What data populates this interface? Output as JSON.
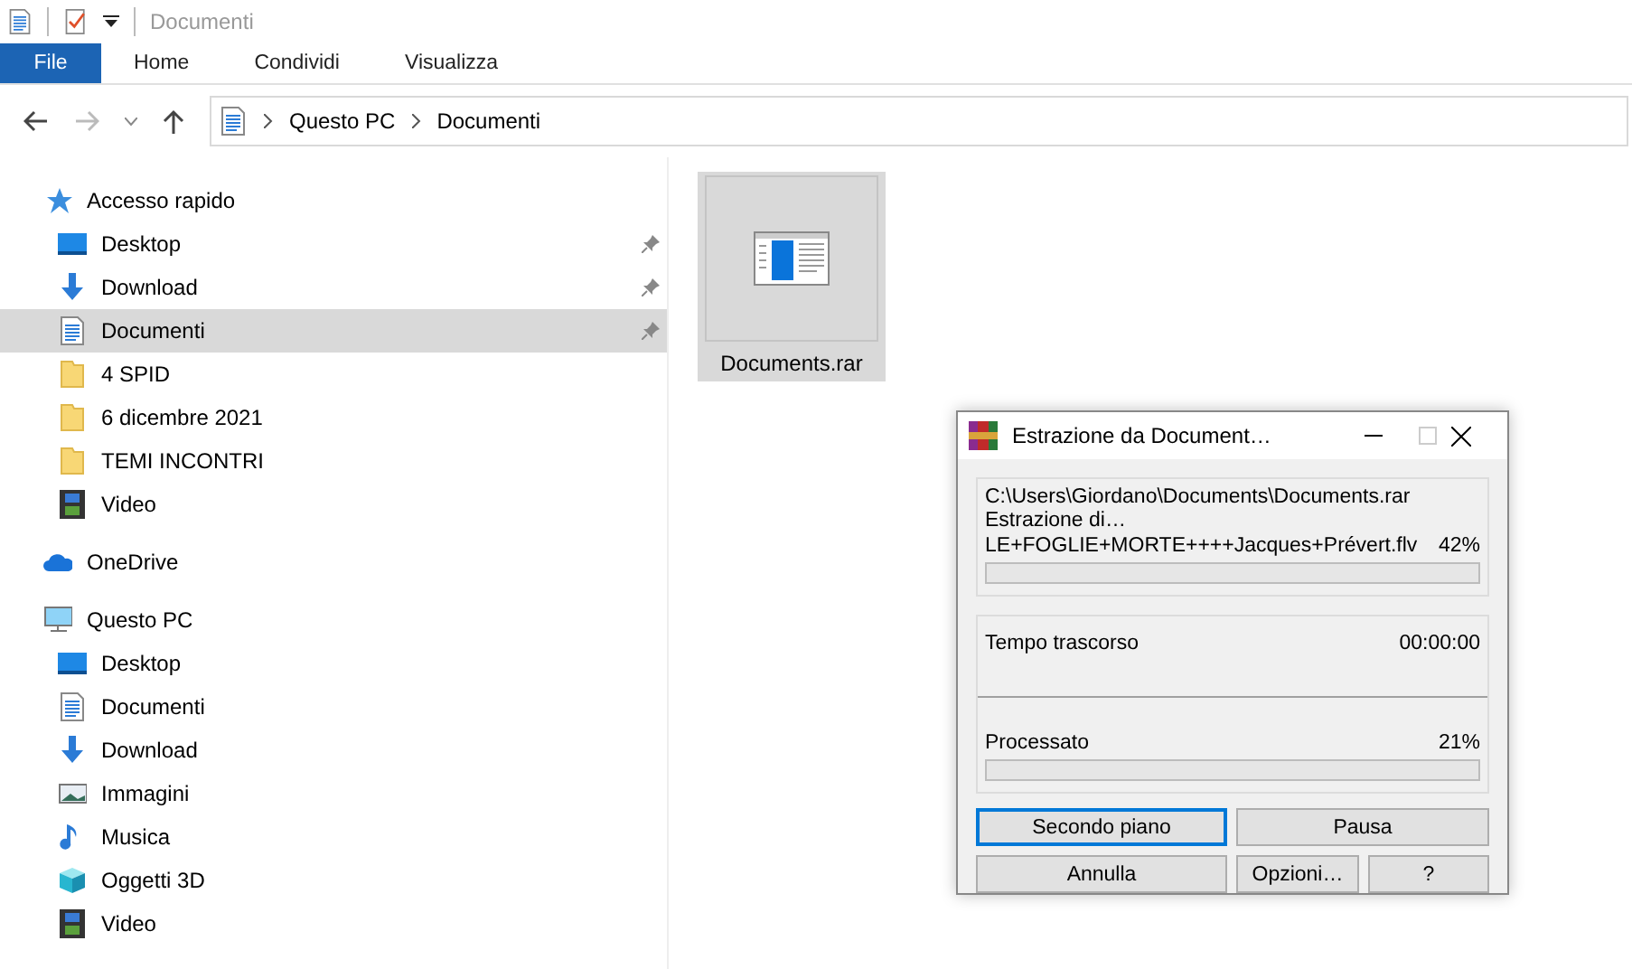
{
  "window": {
    "title": "Documenti"
  },
  "ribbon_tabs": [
    {
      "label": "File",
      "kind": "file",
      "selected": false
    },
    {
      "label": "Home",
      "kind": "tab",
      "selected": false
    },
    {
      "label": "Condividi",
      "kind": "tab",
      "selected": false
    },
    {
      "label": "Visualizza",
      "kind": "tab",
      "selected": false
    }
  ],
  "address_bar": {
    "path": [
      "Questo PC",
      "Documenti"
    ]
  },
  "sidebar": {
    "groups": [
      {
        "label": "Accesso rapido",
        "kind": "star",
        "children": [
          {
            "label": "Desktop",
            "kind": "desktop",
            "pinned": true,
            "selected": false
          },
          {
            "label": "Download",
            "kind": "download",
            "pinned": true,
            "selected": false
          },
          {
            "label": "Documenti",
            "kind": "document",
            "pinned": true,
            "selected": true
          },
          {
            "label": "4 SPID",
            "kind": "folder",
            "pinned": false,
            "selected": false
          },
          {
            "label": "6 dicembre 2021",
            "kind": "folder",
            "pinned": false,
            "selected": false
          },
          {
            "label": "TEMI INCONTRI",
            "kind": "folder",
            "pinned": false,
            "selected": false
          },
          {
            "label": "Video",
            "kind": "video",
            "pinned": false,
            "selected": false
          }
        ]
      },
      {
        "label": "OneDrive",
        "kind": "cloud"
      },
      {
        "label": "Questo PC",
        "kind": "pc",
        "children": [
          {
            "label": "Desktop",
            "kind": "desktop",
            "pinned": false,
            "selected": false
          },
          {
            "label": "Documenti",
            "kind": "document",
            "pinned": false,
            "selected": false
          },
          {
            "label": "Download",
            "kind": "download",
            "pinned": false,
            "selected": false
          },
          {
            "label": "Immagini",
            "kind": "images",
            "pinned": false,
            "selected": false
          },
          {
            "label": "Musica",
            "kind": "music",
            "pinned": false,
            "selected": false
          },
          {
            "label": "Oggetti 3D",
            "kind": "cube",
            "pinned": false,
            "selected": false
          },
          {
            "label": "Video",
            "kind": "video",
            "pinned": false,
            "selected": false
          }
        ]
      }
    ]
  },
  "files": [
    {
      "name": "Documents.rar",
      "selected": true
    }
  ],
  "dialog": {
    "title": "Estrazione da Document…",
    "archive_path": "C:\\Users\\Giordano\\Documents\\Documents.rar",
    "action": "Estrazione di…",
    "current_file": "LE+FOGLIE+MORTE++++Jacques+Prévert.flv",
    "file_percent": "42%",
    "file_progress": {
      "level": 0
    },
    "elapsed_label": "Tempo trascorso",
    "elapsed": "00:00:00",
    "processed_label": "Processato",
    "processed_percent": "21%",
    "total_progress": {
      "level": 0
    },
    "buttons": [
      {
        "label": "Secondo piano",
        "focused": true
      },
      {
        "label": "Pausa",
        "focused": false
      },
      {
        "label": "Annulla",
        "focused": false
      },
      {
        "label": "Opzioni…",
        "focused": false
      },
      {
        "label": "?",
        "focused": false
      }
    ]
  }
}
